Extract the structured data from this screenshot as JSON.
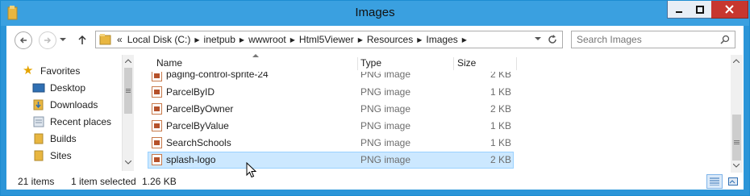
{
  "window": {
    "title": "Images"
  },
  "address": {
    "overflow": "«",
    "segments": [
      "Local Disk (C:)",
      "inetpub",
      "wwwroot",
      "Html5Viewer",
      "Resources",
      "Images"
    ]
  },
  "search": {
    "placeholder": "Search Images"
  },
  "nav": {
    "favorites": "Favorites",
    "items": [
      "Desktop",
      "Downloads",
      "Recent places",
      "Builds",
      "Sites"
    ]
  },
  "columns": {
    "name": "Name",
    "type": "Type",
    "size": "Size"
  },
  "files": [
    {
      "name": "paging-control-sprite-24",
      "type": "PNG image",
      "size": "2 KB"
    },
    {
      "name": "ParcelByID",
      "type": "PNG image",
      "size": "1 KB"
    },
    {
      "name": "ParcelByOwner",
      "type": "PNG image",
      "size": "2 KB"
    },
    {
      "name": "ParcelByValue",
      "type": "PNG image",
      "size": "1 KB"
    },
    {
      "name": "SearchSchools",
      "type": "PNG image",
      "size": "1 KB"
    },
    {
      "name": "splash-logo",
      "type": "PNG image",
      "size": "2 KB",
      "selected": true
    }
  ],
  "status": {
    "count": "21 items",
    "selection": "1 item selected",
    "size": "1.26 KB"
  },
  "colors": {
    "titlebar": "#3aa0e0",
    "close": "#c7372f",
    "selection": "#cce8ff"
  }
}
